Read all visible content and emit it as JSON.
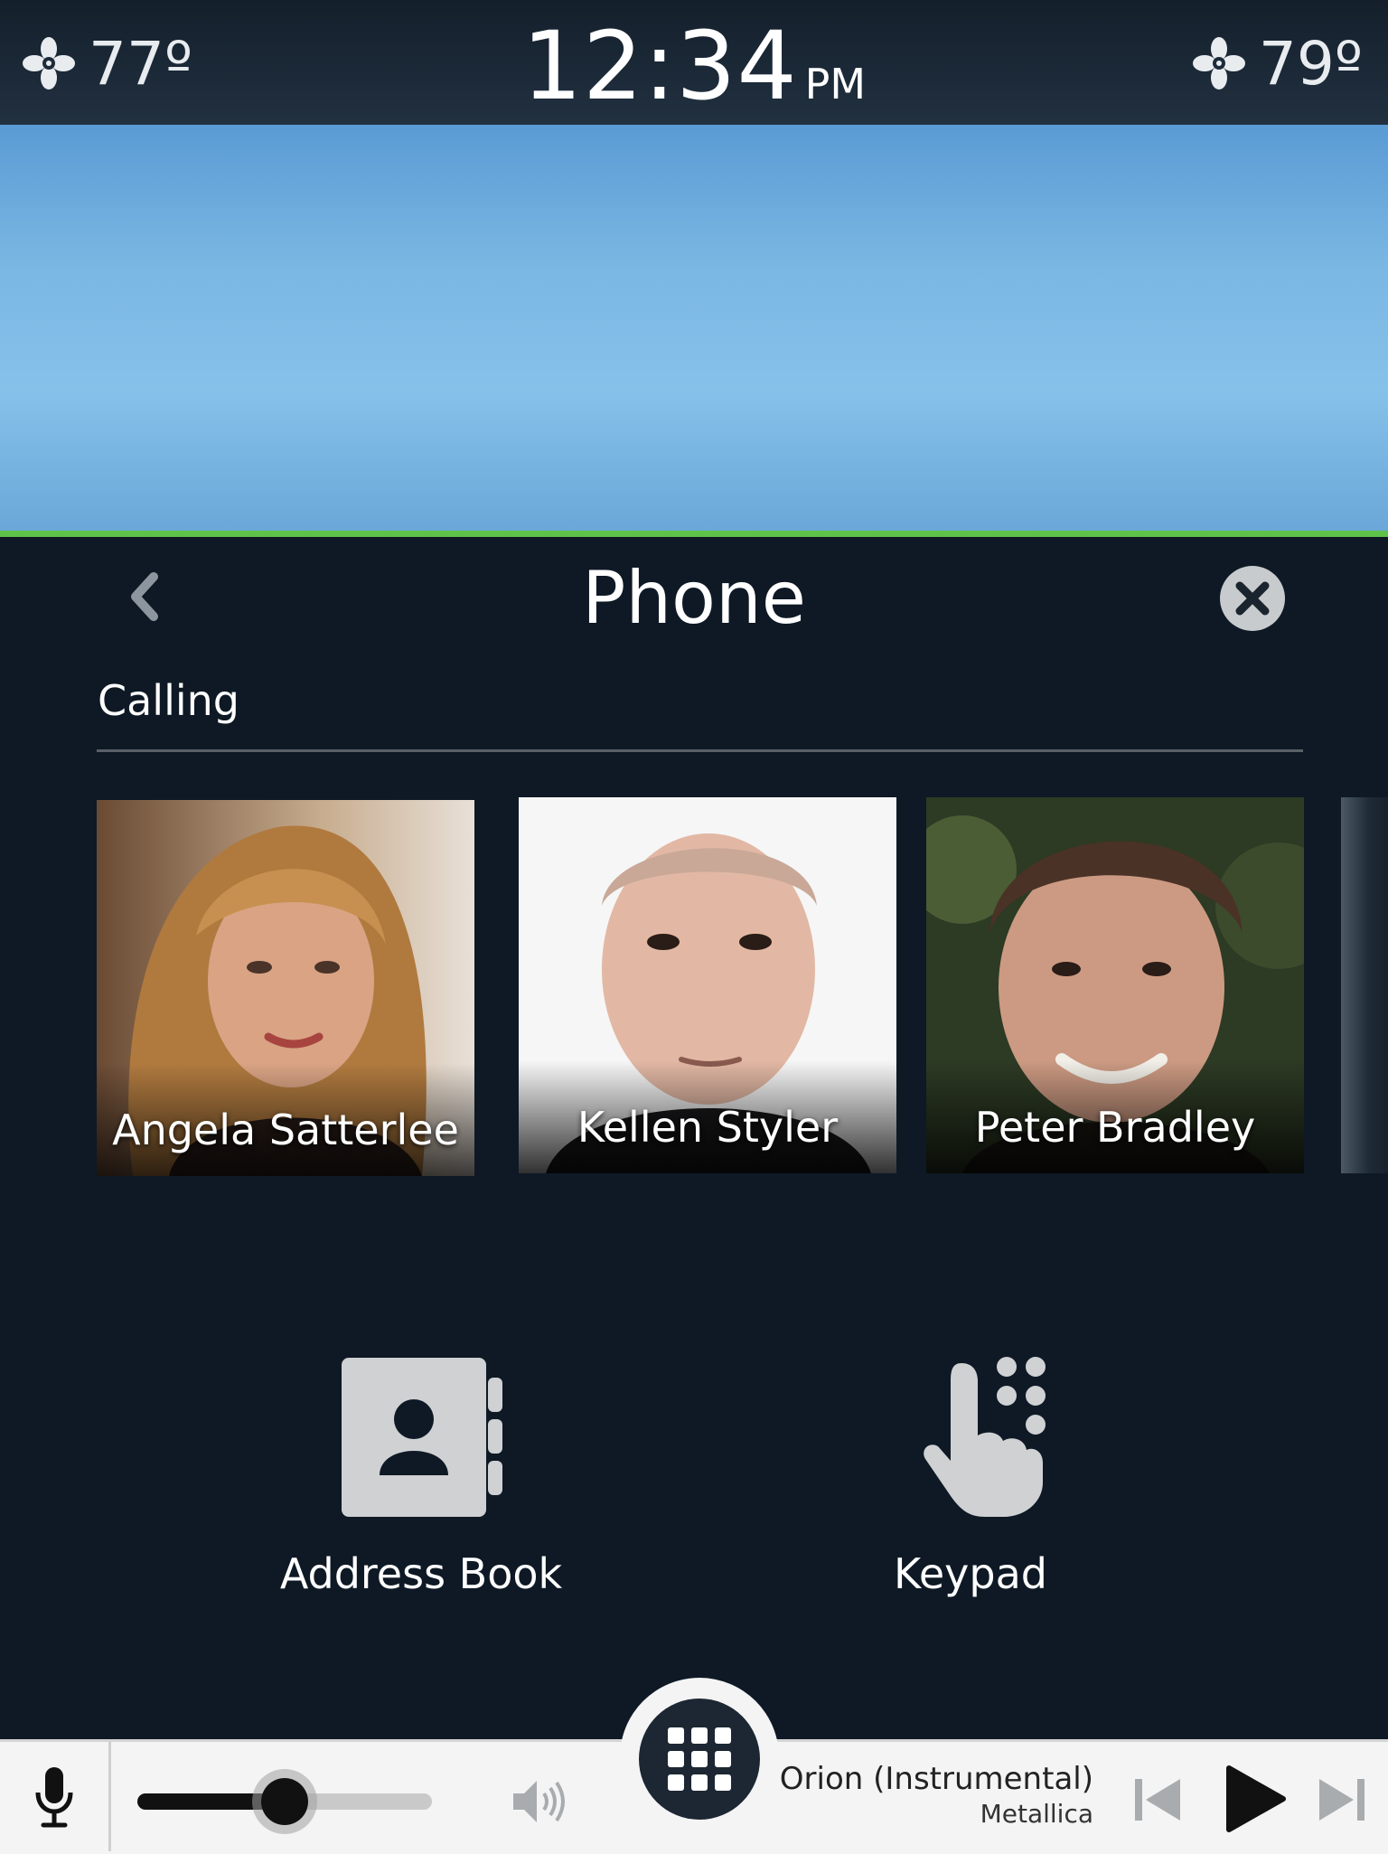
{
  "status_bar": {
    "left_temp": "77º",
    "right_temp": "79º",
    "time": "12:34",
    "ampm": "PM",
    "fan_icon": "fan-icon"
  },
  "phone": {
    "title": "Phone",
    "section": "Calling",
    "back_icon": "chevron-left-icon",
    "close_icon": "close-icon",
    "contacts": [
      {
        "name": "Angela Satterlee"
      },
      {
        "name": "Kellen Styler"
      },
      {
        "name": "Peter Bradley"
      }
    ],
    "actions": {
      "address_book": "Address Book",
      "keypad": "Keypad"
    }
  },
  "media": {
    "volume_level": 0.5,
    "song_title": "Orion (Instrumental)",
    "artist": "Metallica",
    "controls": [
      "previous-icon",
      "play-icon",
      "next-icon"
    ]
  },
  "colors": {
    "accent_green": "#5fc24a",
    "panel_bg": "#0e1925"
  }
}
